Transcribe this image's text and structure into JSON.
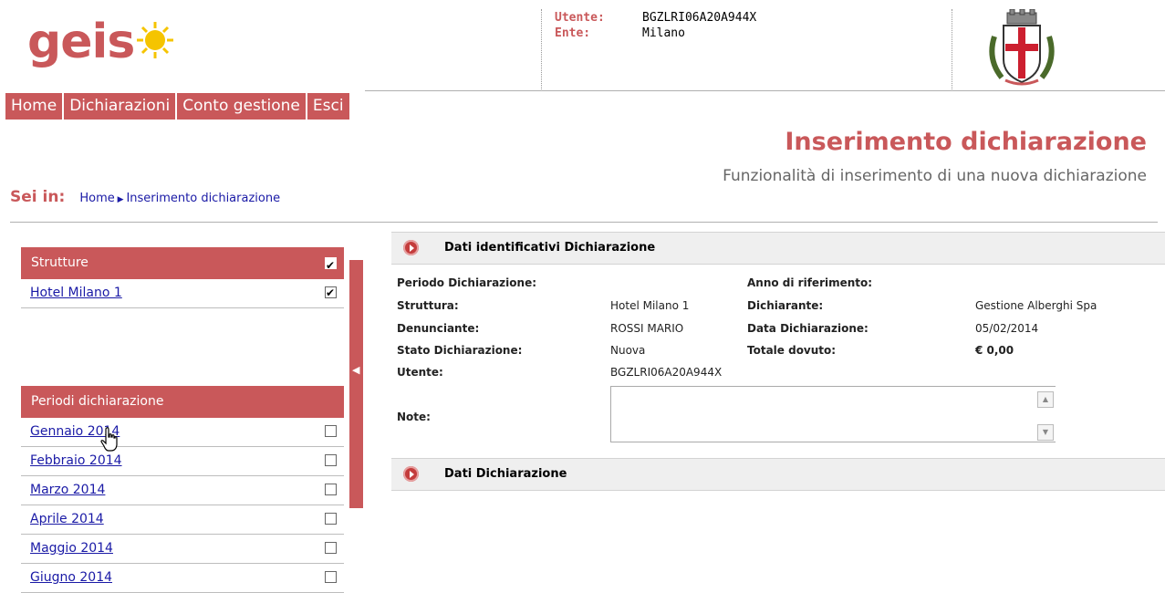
{
  "header": {
    "logo_text": "geis",
    "user_label": "Utente:",
    "user_value": "BGZLRI06A20A944X",
    "ente_label": "Ente:",
    "ente_value": "Milano"
  },
  "menu": [
    "Home",
    "Dichiarazioni",
    "Conto gestione",
    "Esci"
  ],
  "page": {
    "title": "Inserimento dichiarazione",
    "subtitle": "Funzionalità di inserimento di una nuova dichiarazione"
  },
  "breadcrumb": {
    "label": "Sei in:",
    "items": [
      "Home",
      "Inserimento dichiarazione"
    ]
  },
  "strutture": {
    "title": "Strutture",
    "items": [
      {
        "label": "Hotel Milano 1",
        "checked": true
      }
    ]
  },
  "periodi": {
    "title": "Periodi dichiarazione",
    "items": [
      "Gennaio 2014",
      "Febbraio 2014",
      "Marzo 2014",
      "Aprile 2014",
      "Maggio 2014",
      "Giugno 2014"
    ]
  },
  "dati_identificativi": {
    "title": "Dati identificativi Dichiarazione",
    "periodo_label": "Periodo Dichiarazione:",
    "anno_label": "Anno di riferimento:",
    "struttura_label": "Struttura:",
    "struttura_value": "Hotel Milano 1",
    "dichiarante_label": "Dichiarante:",
    "dichiarante_value": "Gestione Alberghi Spa",
    "denunciante_label": "Denunciante:",
    "denunciante_value": "ROSSI MARIO",
    "data_label": "Data Dichiarazione:",
    "data_value": "05/02/2014",
    "stato_label": "Stato Dichiarazione:",
    "stato_value": "Nuova",
    "totale_label": "Totale dovuto:",
    "totale_value": "€ 0,00",
    "utente_label": "Utente:",
    "utente_value": "BGZLRI06A20A944X",
    "note_label": "Note:"
  },
  "dati_dichiarazione": {
    "title": "Dati Dichiarazione"
  }
}
